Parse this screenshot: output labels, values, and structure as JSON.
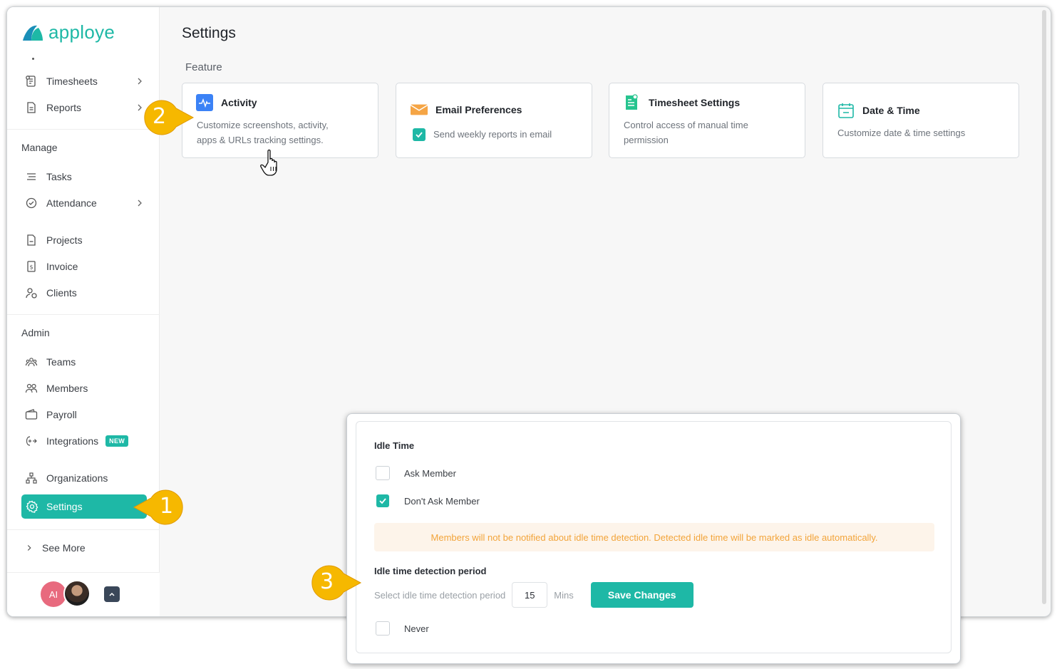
{
  "app": {
    "logo_text": "apploye"
  },
  "sidebar": {
    "items_top": [
      {
        "label": "Timesheets",
        "icon": "timesheet-icon"
      },
      {
        "label": "Reports",
        "icon": "report-icon"
      }
    ],
    "manage_label": "Manage",
    "manage_items": [
      {
        "label": "Tasks",
        "icon": "tasks-icon"
      },
      {
        "label": "Attendance",
        "icon": "attendance-icon"
      },
      {
        "label": "Projects",
        "icon": "projects-icon"
      },
      {
        "label": "Invoice",
        "icon": "invoice-icon"
      },
      {
        "label": "Clients",
        "icon": "clients-icon"
      }
    ],
    "admin_label": "Admin",
    "admin_items": [
      {
        "label": "Teams",
        "icon": "teams-icon"
      },
      {
        "label": "Members",
        "icon": "members-icon"
      },
      {
        "label": "Payroll",
        "icon": "payroll-icon"
      },
      {
        "label": "Integrations",
        "icon": "integrations-icon",
        "badge": "NEW"
      },
      {
        "label": "Organizations",
        "icon": "organizations-icon"
      },
      {
        "label": "Settings",
        "icon": "settings-icon",
        "active": true
      }
    ],
    "see_more": "See More",
    "avatar_initials": "AI"
  },
  "main": {
    "title": "Settings",
    "section_label": "Feature",
    "cards": [
      {
        "title": "Activity",
        "desc_line1": "Customize screenshots, activity,",
        "desc_line2": "apps & URLs tracking settings.",
        "icon": "activity-icon"
      },
      {
        "title": "Email Preferences",
        "desc": "Send weekly reports in email",
        "icon": "email-icon"
      },
      {
        "title": "Timesheet Settings",
        "desc_line1": "Control access of manual time",
        "desc_line2": "permission",
        "icon": "timesheet-settings-icon"
      },
      {
        "title": "Date & Time",
        "desc": "Customize date & time settings",
        "icon": "calendar-icon"
      }
    ]
  },
  "idle_panel": {
    "title": "Idle Time",
    "options": [
      {
        "label": "Ask Member",
        "checked": false
      },
      {
        "label": "Don't Ask Member",
        "checked": true
      }
    ],
    "warning": "Members will not be notified about idle time detection. Detected idle time will be marked as idle automatically.",
    "period_title": "Idle time detection period",
    "period_label": "Select idle time detection period",
    "period_value": "15",
    "period_unit": "Mins",
    "save_label": "Save Changes",
    "never_label": "Never",
    "never_checked": false
  },
  "annotations": {
    "one": "1",
    "two": "2",
    "three": "3"
  },
  "colors": {
    "accent": "#1eb8a6",
    "warning_text": "#f2a43a",
    "warning_bg": "#fdf4ea",
    "marker": "#f6b800"
  }
}
